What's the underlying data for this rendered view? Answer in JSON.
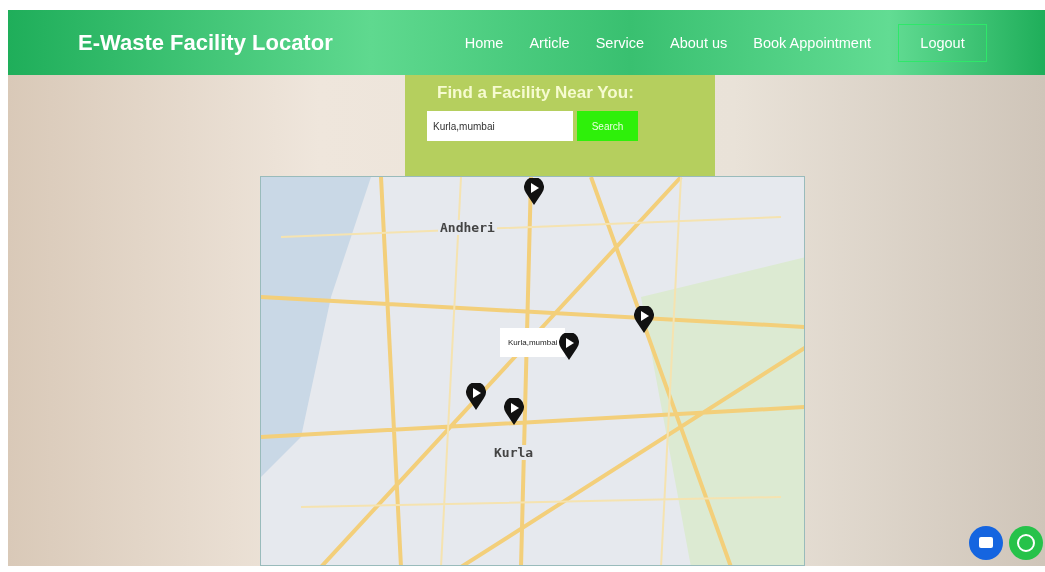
{
  "header": {
    "title": "E-Waste Facility Locator",
    "nav": [
      {
        "label": "Home"
      },
      {
        "label": "Article"
      },
      {
        "label": "Service"
      },
      {
        "label": "About us"
      },
      {
        "label": "Book Appointment"
      }
    ],
    "logout": "Logout"
  },
  "finder": {
    "heading": "Find a Facility Near You:",
    "search": {
      "value": "Kurla,mumbai"
    },
    "button": "Search"
  },
  "map": {
    "place_labels": [
      "Andheri",
      "Kurla"
    ],
    "popup": "Kurla,mumbai"
  }
}
